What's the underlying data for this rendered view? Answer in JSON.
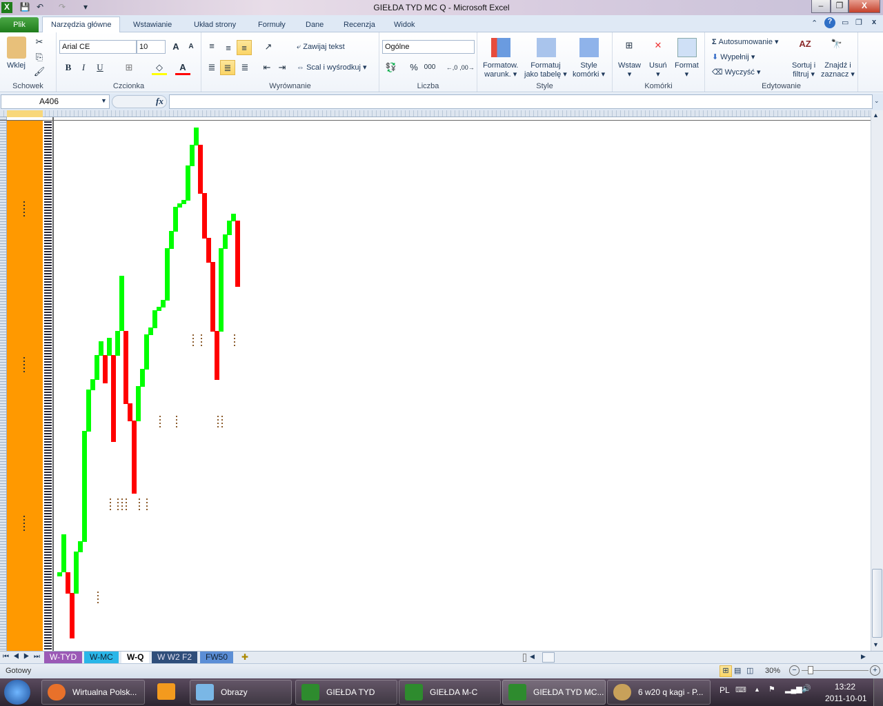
{
  "window": {
    "title": "GIEŁDA TYD MC Q  -  Microsoft Excel",
    "min": "–",
    "max": "❐",
    "close": "X"
  },
  "tabs": [
    {
      "label": "Plik"
    },
    {
      "label": "Narzędzia główne"
    },
    {
      "label": "Wstawianie"
    },
    {
      "label": "Układ strony"
    },
    {
      "label": "Formuły"
    },
    {
      "label": "Dane"
    },
    {
      "label": "Recenzja"
    },
    {
      "label": "Widok"
    }
  ],
  "ribbon": {
    "clipboard": {
      "paste": "Wklej",
      "group": "Schowek"
    },
    "font": {
      "name": "Arial CE",
      "size": "10",
      "bold": "B",
      "italic": "I",
      "underline": "U",
      "grow": "A",
      "shrink": "A",
      "color": "A",
      "group": "Czcionka"
    },
    "alignment": {
      "wrap": "Zawijaj tekst",
      "merge": "Scal i wyśrodkuj",
      "group": "Wyrównanie"
    },
    "number": {
      "format": "Ogólne",
      "percent": "%",
      "thousands": "000",
      "group": "Liczba"
    },
    "styles": {
      "conditional": "Formatow.",
      "conditional2": "warunk.",
      "table": "Formatuj",
      "table2": "jako tabelę",
      "cell": "Style",
      "cell2": "komórki",
      "group": "Style"
    },
    "cells": {
      "insert": "Wstaw",
      "delete": "Usuń",
      "format": "Format",
      "group": "Komórki"
    },
    "editing": {
      "autosum": "Autosumowanie",
      "fill": "Wypełnij",
      "clear": "Wyczyść",
      "sort": "Sortuj i",
      "sort2": "filtruj",
      "find": "Znajdź i",
      "find2": "zaznacz",
      "group": "Edytowanie"
    }
  },
  "formula_bar": {
    "name_box": "A406",
    "fx": "fx",
    "value": ""
  },
  "sheet_tabs": [
    {
      "label": "W-TYD",
      "color": "#9b59b6"
    },
    {
      "label": "W-MC",
      "color": "#29b6e8"
    },
    {
      "label": "W-Q",
      "color": "#ffffff"
    },
    {
      "label": "W W2 F2",
      "color": "#2f4e7a"
    },
    {
      "label": "FW50",
      "color": "#5b8ed6"
    }
  ],
  "status": {
    "text": "Gotowy",
    "zoom": "30%"
  },
  "taskbar": {
    "items": [
      {
        "label": "Wirtualna Polsk..."
      },
      {
        "label": ""
      },
      {
        "label": "Obrazy"
      },
      {
        "label": "GIEŁDA TYD"
      },
      {
        "label": "GIEŁDA M-C"
      },
      {
        "label": "GIEŁDA TYD MC..."
      },
      {
        "label": "6 w20 q kagi - P..."
      }
    ],
    "lang": "PL",
    "time": "13:22",
    "date": "2011-10-01"
  },
  "colors": {
    "up": "#00ff00",
    "down": "#ff0000",
    "column_a": "#ff9900"
  },
  "chart_data": {
    "type": "kagi",
    "title": "",
    "y_units": "price level (arbitrary)",
    "segments": [
      {
        "dir": "up",
        "from": 104,
        "to": 110
      },
      {
        "dir": "up",
        "from": 110,
        "to": 165
      },
      {
        "dir": "down",
        "from": 110,
        "to": 79
      },
      {
        "dir": "down",
        "from": 80,
        "to": 14
      },
      {
        "dir": "up",
        "from": 79,
        "to": 140
      },
      {
        "dir": "up",
        "from": 139,
        "to": 155
      },
      {
        "dir": "up",
        "from": 154,
        "to": 315
      },
      {
        "dir": "up",
        "from": 314,
        "to": 375
      },
      {
        "dir": "up",
        "from": 374,
        "to": 390
      },
      {
        "dir": "up",
        "from": 389,
        "to": 425
      },
      {
        "dir": "up",
        "from": 424,
        "to": 445
      },
      {
        "dir": "down",
        "from": 425,
        "to": 384
      },
      {
        "dir": "up",
        "from": 424,
        "to": 450
      },
      {
        "dir": "down",
        "from": 425,
        "to": 299
      },
      {
        "dir": "up",
        "from": 424,
        "to": 460
      },
      {
        "dir": "up",
        "from": 460,
        "to": 540
      },
      {
        "dir": "down",
        "from": 460,
        "to": 354
      },
      {
        "dir": "down",
        "from": 355,
        "to": 329
      },
      {
        "dir": "down",
        "from": 330,
        "to": 224
      },
      {
        "dir": "up",
        "from": 329,
        "to": 380
      },
      {
        "dir": "up",
        "from": 379,
        "to": 405
      },
      {
        "dir": "up",
        "from": 404,
        "to": 455
      },
      {
        "dir": "up",
        "from": 454,
        "to": 465
      },
      {
        "dir": "up",
        "from": 464,
        "to": 490
      },
      {
        "dir": "up",
        "from": 489,
        "to": 495
      },
      {
        "dir": "up",
        "from": 494,
        "to": 505
      },
      {
        "dir": "up",
        "from": 504,
        "to": 580
      },
      {
        "dir": "up",
        "from": 579,
        "to": 605
      },
      {
        "dir": "up",
        "from": 604,
        "to": 640
      },
      {
        "dir": "up",
        "from": 639,
        "to": 645
      },
      {
        "dir": "up",
        "from": 644,
        "to": 650
      },
      {
        "dir": "up",
        "from": 649,
        "to": 700
      },
      {
        "dir": "up",
        "from": 699,
        "to": 730
      },
      {
        "dir": "up",
        "from": 729,
        "to": 755
      },
      {
        "dir": "down",
        "from": 730,
        "to": 659
      },
      {
        "dir": "down",
        "from": 660,
        "to": 594
      },
      {
        "dir": "down",
        "from": 595,
        "to": 559
      },
      {
        "dir": "down",
        "from": 560,
        "to": 459
      },
      {
        "dir": "down",
        "from": 460,
        "to": 389
      },
      {
        "dir": "up",
        "from": 459,
        "to": 580
      },
      {
        "dir": "up",
        "from": 579,
        "to": 600
      },
      {
        "dir": "up",
        "from": 599,
        "to": 620
      },
      {
        "dir": "up",
        "from": 619,
        "to": 630
      },
      {
        "dir": "down",
        "from": 620,
        "to": 524
      }
    ],
    "ylim": [
      0,
      760
    ]
  }
}
